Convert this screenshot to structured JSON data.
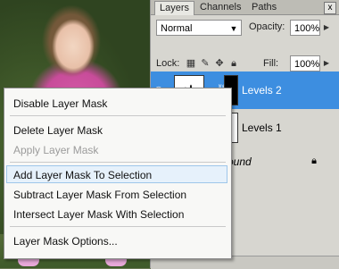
{
  "panel": {
    "tabs": [
      "Layers",
      "Channels",
      "Paths"
    ],
    "close_glyph": "x",
    "blend_mode": "Normal",
    "opacity_label": "Opacity:",
    "opacity_value": "100%",
    "lock_label": "Lock:",
    "fill_label": "Fill:",
    "fill_value": "100%",
    "layers": [
      {
        "name": "Levels 2",
        "selected": true
      },
      {
        "name": "Levels 1",
        "selected": false
      },
      {
        "name": "ound",
        "selected": false
      }
    ]
  },
  "context_menu": {
    "items": [
      {
        "label": "Disable Layer Mask",
        "enabled": true
      },
      {
        "label": "Delete Layer Mask",
        "enabled": true
      },
      {
        "label": "Apply Layer Mask",
        "enabled": false
      },
      {
        "label": "Add Layer Mask To Selection",
        "enabled": true,
        "hovered": true
      },
      {
        "label": "Subtract Layer Mask From Selection",
        "enabled": true
      },
      {
        "label": "Intersect Layer Mask With Selection",
        "enabled": true
      },
      {
        "label": "Layer Mask Options...",
        "enabled": true
      }
    ]
  },
  "colors": {
    "selection_blue": "#3d8ee0",
    "menu_hover": "#e6f1fb"
  }
}
